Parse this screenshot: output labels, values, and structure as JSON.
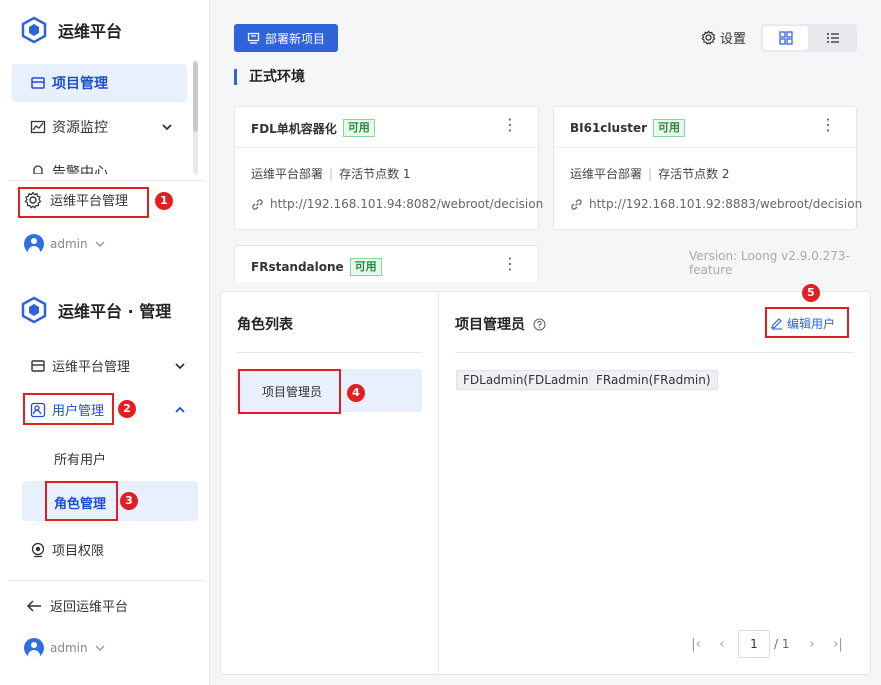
{
  "top": {
    "brand": "运维平台",
    "nav": [
      {
        "label": "项目管理",
        "icon": "project-list-icon"
      },
      {
        "label": "资源监控",
        "icon": "monitor-chart-icon"
      },
      {
        "label": "告警中心",
        "icon": "alarm-icon"
      },
      {
        "label": "运维平台管理",
        "icon": "gear-icon"
      }
    ],
    "user": "admin",
    "deploy_button": "部署新项目",
    "settings_label": "设置",
    "section_title": "正式环境",
    "cards": [
      {
        "name": "FDL单机容器化",
        "status": "可用",
        "deploy": "运维平台部署",
        "nodes": "存活节点数 1",
        "url": "http://192.168.101.94:8082/webroot/decision"
      },
      {
        "name": "BI61cluster",
        "status": "可用",
        "deploy": "运维平台部署",
        "nodes": "存活节点数 2",
        "url": "http://192.168.101.92:8883/webroot/decision"
      },
      {
        "name": "FRstandalone",
        "status": "可用"
      }
    ],
    "version": "Version: Loong v2.9.0.273-feature"
  },
  "bottom": {
    "brand": "运维平台 · 管理",
    "nav": {
      "ops_admin": "运维平台管理",
      "user_mgmt": "用户管理",
      "all_users": "所有用户",
      "role_mgmt": "角色管理",
      "project_perm": "项目权限",
      "back": "返回运维平台"
    },
    "user": "admin",
    "role_list_title": "角色列表",
    "roles": [
      "项目管理员"
    ],
    "detail_title": "项目管理员",
    "edit_users": "编辑用户",
    "members": [
      "FDLadmin(FDLadmin)",
      "FRadmin(FRadmin)"
    ],
    "pager": {
      "current": "1",
      "total": "/ 1"
    }
  },
  "annotations": [
    "1",
    "2",
    "3",
    "4",
    "5"
  ],
  "colors": {
    "primary": "#2f63db",
    "annotation": "#e02020",
    "active_bg": "#e8effd"
  }
}
